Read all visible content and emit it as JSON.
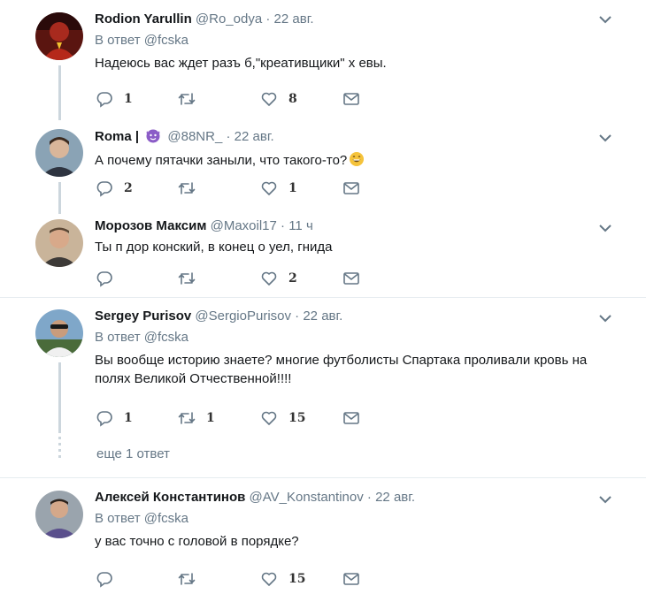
{
  "tweets": [
    {
      "name": "Rodion Yarullin",
      "handle": "@Ro_odya",
      "dot": "·",
      "time": "22 авг.",
      "reply_prefix": "В ответ",
      "reply_to": "@fcska",
      "text": "Надеюсь вас ждет разъ  б,\"креативщики\" х  евы.",
      "replies": "1",
      "retweets": "",
      "likes": "8"
    },
    {
      "name": "Roma |",
      "handle": "@88NR_",
      "dot": "·",
      "time": "22 авг.",
      "text": "А почему пятачки заныли, что такого-то?",
      "replies": "2",
      "retweets": "",
      "likes": "1"
    },
    {
      "name": "Морозов Максим",
      "handle": "@Maxoil17",
      "dot": "·",
      "time": "11 ч",
      "text": "Ты п  дор конский, в конец о  уел, гнида",
      "replies": "",
      "retweets": "",
      "likes": "2"
    },
    {
      "name": "Sergey Purisov",
      "handle": "@SergioPurisov",
      "dot": "·",
      "time": "22 авг.",
      "reply_prefix": "В ответ",
      "reply_to": "@fcska",
      "text": "Вы вообще историю знаете?  многие футболисты Спартака проливали кровь на полях Великой Отчественной!!!!",
      "replies": "1",
      "retweets": "1",
      "likes": "15"
    },
    {
      "name": "Алексей Константинов",
      "handle": "@AV_Konstantinov",
      "dot": "·",
      "time": "22 авг.",
      "reply_prefix": "В ответ",
      "reply_to": "@fcska",
      "text": "у вас точно с головой в порядке?",
      "replies": "",
      "retweets": "",
      "likes": "15"
    }
  ],
  "more_replies": "еще 1 ответ",
  "colors": {
    "icon": "#657786",
    "thread": "#ccd6dd",
    "separator": "#e6ecf0"
  }
}
